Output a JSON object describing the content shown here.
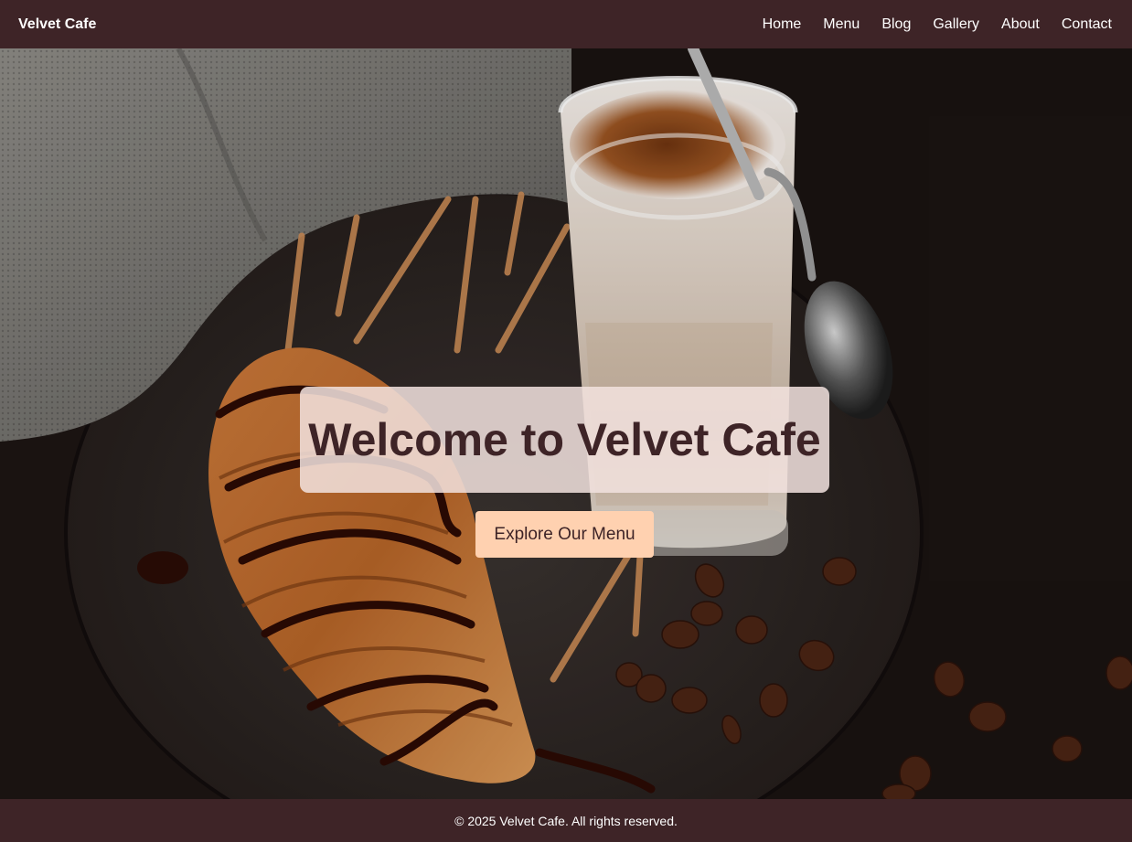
{
  "brand": {
    "name": "Velvet Cafe"
  },
  "nav": {
    "items": [
      {
        "label": "Home"
      },
      {
        "label": "Menu"
      },
      {
        "label": "Blog"
      },
      {
        "label": "Gallery"
      },
      {
        "label": "About"
      },
      {
        "label": "Contact"
      }
    ]
  },
  "hero": {
    "title": "Welcome to Velvet Cafe",
    "cta_label": "Explore Our Menu",
    "image_subject": "latte-glass-croissant-coffee-beans"
  },
  "footer": {
    "text": "© 2025 Velvet Cafe. All rights reserved."
  },
  "colors": {
    "nav_bg": "#3e2427",
    "footer_bg": "#3e2427",
    "title_color": "#3e2427",
    "cta_bg": "#ffd1b0",
    "overlay_bg": "#f2e2de"
  }
}
